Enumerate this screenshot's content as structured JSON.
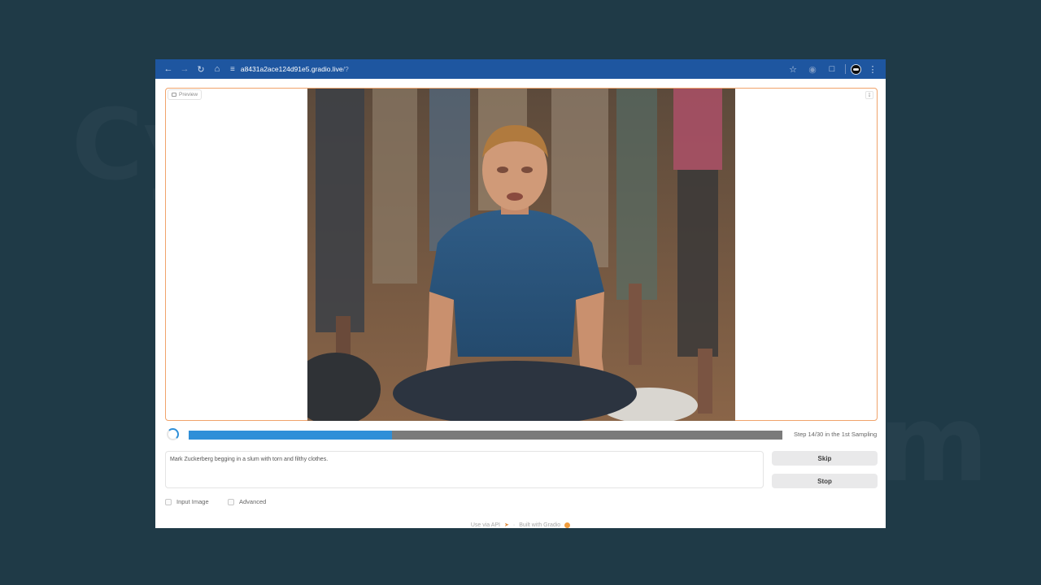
{
  "browser": {
    "url_host": "a8431a2ace124d91e5.gradio.live",
    "url_path": "/?"
  },
  "preview": {
    "label": "Preview"
  },
  "progress": {
    "fraction": 0.342,
    "step_text": "Step 14/30 in the 1st Sampling"
  },
  "prompt": {
    "value": "Mark Zuckerberg begging in a slum with torn and filthy clothes."
  },
  "buttons": {
    "skip": "Skip",
    "stop": "Stop"
  },
  "options": {
    "input_image": "Input Image",
    "advanced": "Advanced"
  },
  "footer": {
    "api": "Use via API",
    "built": "Built with Gradio",
    "separator": "·"
  },
  "colors": {
    "progress_fill": "#2f8fd8",
    "progress_track": "#7b7b7b",
    "preview_border": "#f0a36b",
    "browser_toolbar": "#1e56a0",
    "background": "#1f3a47"
  },
  "icons": [
    "back-icon",
    "forward-icon",
    "reload-icon",
    "home-icon",
    "site-settings-icon",
    "bookmark-star-icon",
    "microphone-icon",
    "extensions-icon",
    "profile-avatar-icon",
    "menu-kebab-icon",
    "image-icon",
    "download-icon",
    "rocket-icon",
    "gradio-logo-icon"
  ]
}
